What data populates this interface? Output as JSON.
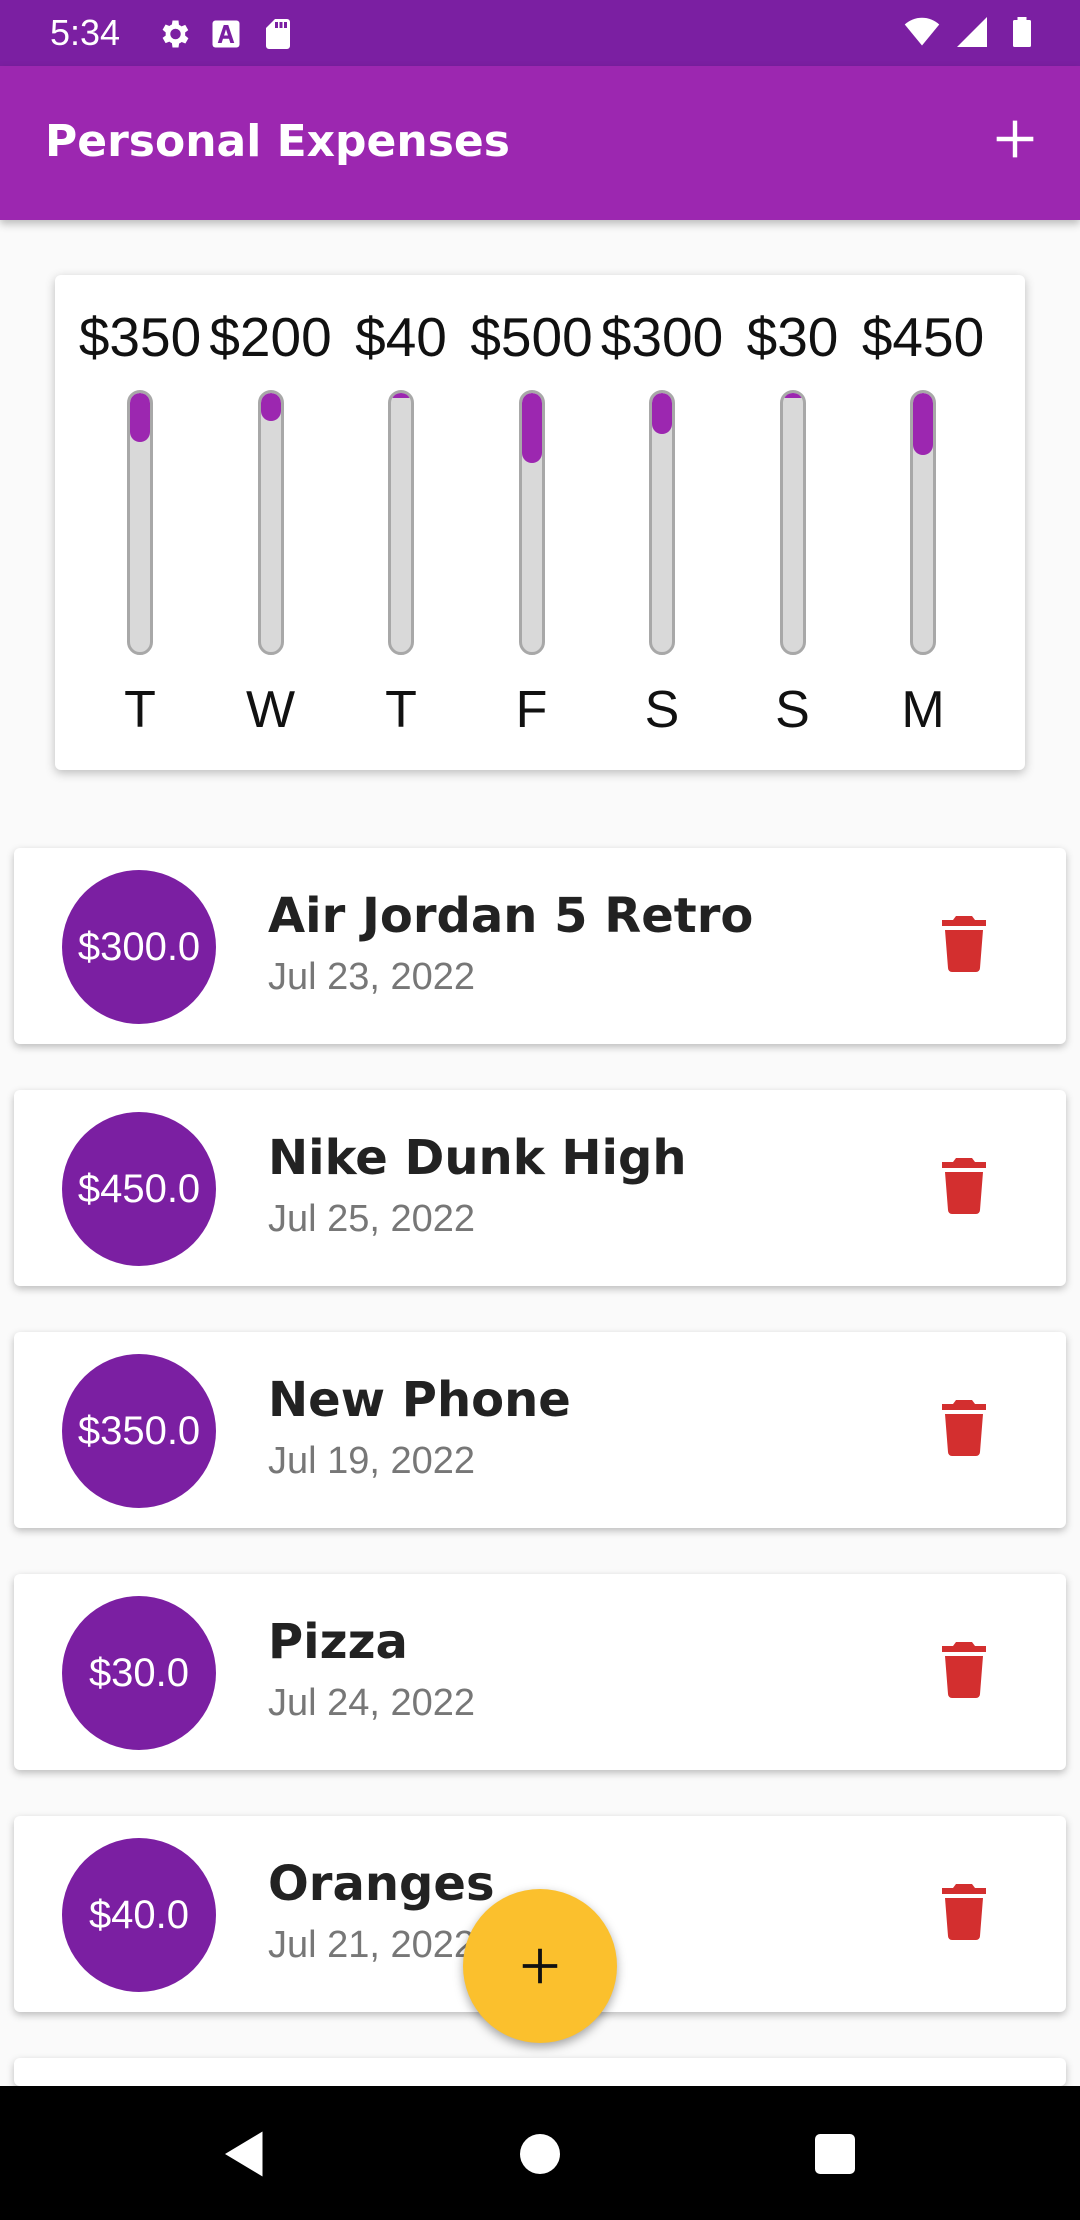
{
  "status_bar": {
    "time": "5:34",
    "icons_left": [
      "gear-icon",
      "font-icon",
      "sdcard-icon"
    ],
    "icons_right": [
      "wifi-icon",
      "signal-icon",
      "battery-icon"
    ]
  },
  "app_bar": {
    "title": "Personal Expenses",
    "add_icon": "plus-icon"
  },
  "chart_data": {
    "type": "bar",
    "categories": [
      "T",
      "W",
      "T",
      "F",
      "S",
      "S",
      "M"
    ],
    "labels": [
      "$350",
      "$200",
      "$40",
      "$500",
      "$300",
      "$30",
      "$450"
    ],
    "values": [
      350,
      200,
      40,
      500,
      300,
      30,
      450
    ],
    "fill_fraction": [
      0.19,
      0.11,
      0.02,
      0.27,
      0.16,
      0.02,
      0.24
    ],
    "colors": {
      "fill": "#9c27b0",
      "track": "#d9d9d9"
    }
  },
  "expenses": [
    {
      "amount": "$300.0",
      "title": "Air Jordan 5 Retro",
      "date": "Jul 23, 2022"
    },
    {
      "amount": "$450.0",
      "title": "Nike Dunk High",
      "date": "Jul 25, 2022"
    },
    {
      "amount": "$350.0",
      "title": "New Phone",
      "date": "Jul 19, 2022"
    },
    {
      "amount": "$30.0",
      "title": "Pizza",
      "date": "Jul 24, 2022"
    },
    {
      "amount": "$40.0",
      "title": "Oranges",
      "date": "Jul 21, 2022"
    }
  ],
  "fab": {
    "icon": "plus-icon",
    "color": "#fbc02d"
  },
  "nav_bar": {
    "icons": [
      "back-icon",
      "home-icon",
      "recents-icon"
    ]
  },
  "colors": {
    "primary": "#9c27b0",
    "primary_dark": "#7b1fa2",
    "delete": "#d32f2f"
  }
}
